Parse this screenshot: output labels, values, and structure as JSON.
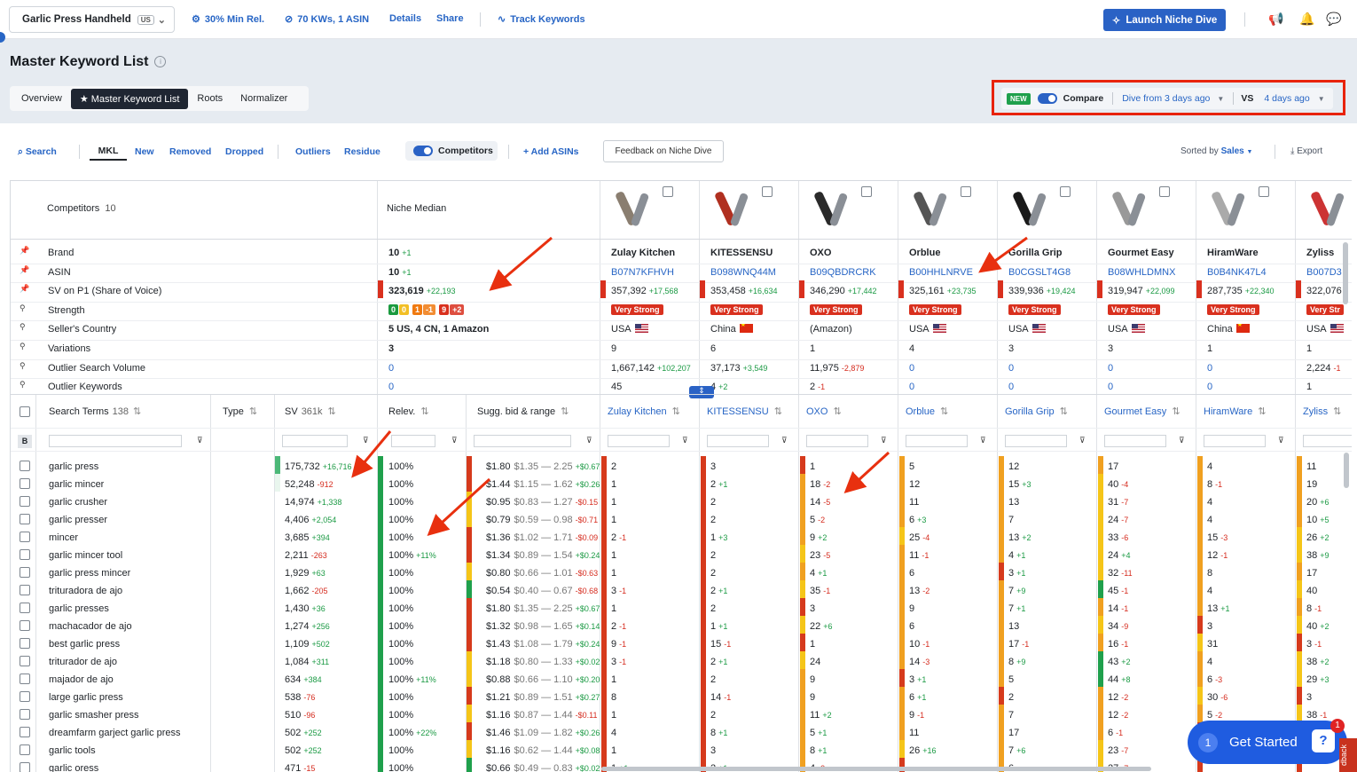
{
  "topbar": {
    "product": "Garlic Press Handheld",
    "market": "US",
    "min_rel": "30% Min Rel.",
    "kws": "70 KWs, 1 ASIN",
    "details": "Details",
    "share": "Share",
    "track": "Track Keywords",
    "launch": "Launch Niche Dive"
  },
  "page": {
    "title": "Master Keyword List",
    "tabs": [
      "Overview",
      "Master Keyword List",
      "Roots",
      "Normalizer"
    ]
  },
  "compare": {
    "new": "NEW",
    "label": "Compare",
    "from": "Dive from 3 days ago",
    "vs": "VS",
    "to": "4 days ago"
  },
  "toolbar": {
    "search": "Search",
    "mkl": "MKL",
    "new": "New",
    "removed": "Removed",
    "dropped": "Dropped",
    "outliers": "Outliers",
    "residue": "Residue",
    "competitors": "Competitors",
    "add": "+ Add ASINs",
    "feedback": "Feedback on Niche Dive",
    "sorted": "Sorted by",
    "sorted_val": "Sales",
    "export": "Export"
  },
  "header": {
    "competitors_label": "Competitors",
    "competitors_count": "10",
    "niche_median": "Niche Median"
  },
  "attrs": [
    "Brand",
    "ASIN",
    "SV on P1 (Share of Voice)",
    "Strength",
    "Seller's Country",
    "Variations",
    "Outlier Search Volume",
    "Outlier Keywords"
  ],
  "median": {
    "brand": "10",
    "brand_d": "+1",
    "asin": "10",
    "asin_d": "+1",
    "sv": "323,619",
    "sv_d": "+22,193",
    "country": "5 US, 4 CN, 1 Amazon",
    "variations": "3",
    "osv": "0",
    "okw": "0",
    "strength": [
      {
        "v": "0",
        "c": "#1a9a3f"
      },
      {
        "v": "0",
        "c": "#f0b400"
      },
      {
        "v": "1",
        "c": "#f07a10"
      },
      {
        "v": "-1",
        "c": "#f07a10"
      },
      {
        "v": "9",
        "c": "#d9301e"
      },
      {
        "v": "+2",
        "c": "#d9301e"
      }
    ]
  },
  "competitors": [
    {
      "brand": "Zulay Kitchen",
      "asin": "B07N7KFHVH",
      "sv": "357,392",
      "sv_d": "+17,568",
      "strength": "Very Strong",
      "country": "USA",
      "flag": "us",
      "var": "9",
      "osv": "1,667,142",
      "osv_d": "+102,207",
      "okw": "45",
      "okw_d": ""
    },
    {
      "brand": "KITESSENSU",
      "asin": "B098WNQ44M",
      "sv": "353,458",
      "sv_d": "+16,634",
      "strength": "Very Strong",
      "country": "China",
      "flag": "cn",
      "var": "6",
      "osv": "37,173",
      "osv_d": "+3,549",
      "okw": "4",
      "okw_d": "+2"
    },
    {
      "brand": "OXO",
      "asin": "B09QBDRCRK",
      "sv": "346,290",
      "sv_d": "+17,442",
      "strength": "Very Strong",
      "country": "(Amazon)",
      "flag": "",
      "var": "1",
      "osv": "11,975",
      "osv_d": "-2,879",
      "okw": "2",
      "okw_d": "-1"
    },
    {
      "brand": "Orblue",
      "asin": "B00HHLNRVE",
      "sv": "325,161",
      "sv_d": "+23,735",
      "strength": "Very Strong",
      "country": "USA",
      "flag": "us",
      "var": "4",
      "osv": "0",
      "osv_d": "",
      "okw": "0",
      "okw_d": ""
    },
    {
      "brand": "Gorilla Grip",
      "asin": "B0CGSLT4G8",
      "sv": "339,936",
      "sv_d": "+19,424",
      "strength": "Very Strong",
      "country": "USA",
      "flag": "us",
      "var": "3",
      "osv": "0",
      "osv_d": "",
      "okw": "0",
      "okw_d": ""
    },
    {
      "brand": "Gourmet Easy",
      "asin": "B08WHLDMNX",
      "sv": "319,947",
      "sv_d": "+22,099",
      "strength": "Very Strong",
      "country": "USA",
      "flag": "us",
      "var": "3",
      "osv": "0",
      "osv_d": "",
      "okw": "0",
      "okw_d": ""
    },
    {
      "brand": "HiramWare",
      "asin": "B0B4NK47L4",
      "sv": "287,735",
      "sv_d": "+22,340",
      "strength": "Very Strong",
      "country": "China",
      "flag": "cn",
      "var": "1",
      "osv": "0",
      "osv_d": "",
      "okw": "0",
      "okw_d": ""
    },
    {
      "brand": "Zyliss",
      "asin": "B007D3",
      "sv": "322,076",
      "sv_d": "",
      "strength": "Very Str",
      "country": "USA",
      "flag": "us",
      "var": "1",
      "osv": "2,224",
      "osv_d": "-1",
      "okw": "1",
      "okw_d": ""
    }
  ],
  "kwheader": {
    "search_terms": "Search Terms",
    "count": "138",
    "type": "Type",
    "sv": "SV",
    "sv_total": "361k",
    "relev": "Relev.",
    "bid": "Sugg. bid & range",
    "b": "B"
  },
  "rows": [
    {
      "t": "garlic press",
      "sv": "175,732",
      "svd": "+16,716",
      "rel": "100%",
      "reld": "",
      "bid": "$1.80",
      "lo": "$1.35",
      "hi": "2.25",
      "bd": "+$0.67",
      "r": [
        [
          "2",
          ""
        ],
        [
          "3",
          ""
        ],
        [
          "1",
          ""
        ],
        [
          "5",
          ""
        ],
        [
          "12",
          ""
        ],
        [
          "17",
          ""
        ],
        [
          "4",
          ""
        ],
        [
          "11",
          ""
        ]
      ]
    },
    {
      "t": "garlic mincer",
      "sv": "52,248",
      "svd": "-912",
      "rel": "100%",
      "reld": "",
      "bid": "$1.44",
      "lo": "$1.15",
      "hi": "1.62",
      "bd": "+$0.26",
      "r": [
        [
          "1",
          ""
        ],
        [
          "2",
          "+1"
        ],
        [
          "18",
          "-2"
        ],
        [
          "12",
          ""
        ],
        [
          "15",
          "+3"
        ],
        [
          "40",
          "-4"
        ],
        [
          "8",
          "-1"
        ],
        [
          "19",
          ""
        ]
      ]
    },
    {
      "t": "garlic crusher",
      "sv": "14,974",
      "svd": "+1,338",
      "rel": "100%",
      "reld": "",
      "bid": "$0.95",
      "lo": "$0.83",
      "hi": "1.27",
      "bd": "-$0.15",
      "r": [
        [
          "1",
          ""
        ],
        [
          "2",
          ""
        ],
        [
          "14",
          "-5"
        ],
        [
          "11",
          ""
        ],
        [
          "13",
          ""
        ],
        [
          "31",
          "-7"
        ],
        [
          "4",
          ""
        ],
        [
          "20",
          "+6"
        ]
      ]
    },
    {
      "t": "garlic presser",
      "sv": "4,406",
      "svd": "+2,054",
      "rel": "100%",
      "reld": "",
      "bid": "$0.79",
      "lo": "$0.59",
      "hi": "0.98",
      "bd": "-$0.71",
      "r": [
        [
          "1",
          ""
        ],
        [
          "2",
          ""
        ],
        [
          "5",
          "-2"
        ],
        [
          "6",
          "+3"
        ],
        [
          "7",
          ""
        ],
        [
          "24",
          "-7"
        ],
        [
          "4",
          ""
        ],
        [
          "10",
          "+5"
        ]
      ]
    },
    {
      "t": "mincer",
      "sv": "3,685",
      "svd": "+394",
      "rel": "100%",
      "reld": "",
      "bid": "$1.36",
      "lo": "$1.02",
      "hi": "1.71",
      "bd": "-$0.09",
      "r": [
        [
          "2",
          "-1"
        ],
        [
          "1",
          "+3"
        ],
        [
          "9",
          "+2"
        ],
        [
          "25",
          "-4"
        ],
        [
          "13",
          "+2"
        ],
        [
          "33",
          "-6"
        ],
        [
          "15",
          "-3"
        ],
        [
          "26",
          "+2"
        ]
      ]
    },
    {
      "t": "garlic mincer tool",
      "sv": "2,211",
      "svd": "-263",
      "rel": "100%",
      "reld": "+11%",
      "bid": "$1.34",
      "lo": "$0.89",
      "hi": "1.54",
      "bd": "+$0.24",
      "r": [
        [
          "1",
          ""
        ],
        [
          "2",
          ""
        ],
        [
          "23",
          "-5"
        ],
        [
          "11",
          "-1"
        ],
        [
          "4",
          "+1"
        ],
        [
          "24",
          "+4"
        ],
        [
          "12",
          "-1"
        ],
        [
          "38",
          "+9"
        ]
      ]
    },
    {
      "t": "garlic press mincer",
      "sv": "1,929",
      "svd": "+63",
      "rel": "100%",
      "reld": "",
      "bid": "$0.80",
      "lo": "$0.66",
      "hi": "1.01",
      "bd": "-$0.63",
      "r": [
        [
          "1",
          ""
        ],
        [
          "2",
          ""
        ],
        [
          "4",
          "+1"
        ],
        [
          "6",
          ""
        ],
        [
          "3",
          "+1"
        ],
        [
          "32",
          "-11"
        ],
        [
          "8",
          ""
        ],
        [
          "17",
          ""
        ]
      ]
    },
    {
      "t": "trituradora de ajo",
      "sv": "1,662",
      "svd": "-205",
      "rel": "100%",
      "reld": "",
      "bid": "$0.54",
      "lo": "$0.40",
      "hi": "0.67",
      "bd": "-$0.68",
      "r": [
        [
          "3",
          "-1"
        ],
        [
          "2",
          "+1"
        ],
        [
          "35",
          "-1"
        ],
        [
          "13",
          "-2"
        ],
        [
          "7",
          "+9"
        ],
        [
          "45",
          "-1"
        ],
        [
          "4",
          ""
        ],
        [
          "40",
          ""
        ]
      ]
    },
    {
      "t": "garlic presses",
      "sv": "1,430",
      "svd": "+36",
      "rel": "100%",
      "reld": "",
      "bid": "$1.80",
      "lo": "$1.35",
      "hi": "2.25",
      "bd": "+$0.67",
      "r": [
        [
          "1",
          ""
        ],
        [
          "2",
          ""
        ],
        [
          "3",
          ""
        ],
        [
          "9",
          ""
        ],
        [
          "7",
          "+1"
        ],
        [
          "14",
          "-1"
        ],
        [
          "13",
          "+1"
        ],
        [
          "8",
          "-1"
        ]
      ]
    },
    {
      "t": "machacador de ajo",
      "sv": "1,274",
      "svd": "+256",
      "rel": "100%",
      "reld": "",
      "bid": "$1.32",
      "lo": "$0.98",
      "hi": "1.65",
      "bd": "+$0.14",
      "r": [
        [
          "2",
          "-1"
        ],
        [
          "1",
          "+1"
        ],
        [
          "22",
          "+6"
        ],
        [
          "6",
          ""
        ],
        [
          "13",
          ""
        ],
        [
          "34",
          "-9"
        ],
        [
          "3",
          ""
        ],
        [
          "40",
          "+2"
        ]
      ]
    },
    {
      "t": "best garlic press",
      "sv": "1,109",
      "svd": "+502",
      "rel": "100%",
      "reld": "",
      "bid": "$1.43",
      "lo": "$1.08",
      "hi": "1.79",
      "bd": "+$0.24",
      "r": [
        [
          "9",
          "-1"
        ],
        [
          "15",
          "-1"
        ],
        [
          "1",
          ""
        ],
        [
          "10",
          "-1"
        ],
        [
          "17",
          "-1"
        ],
        [
          "16",
          "-1"
        ],
        [
          "31",
          ""
        ],
        [
          "3",
          "-1"
        ]
      ]
    },
    {
      "t": "triturador de ajo",
      "sv": "1,084",
      "svd": "+311",
      "rel": "100%",
      "reld": "",
      "bid": "$1.18",
      "lo": "$0.80",
      "hi": "1.33",
      "bd": "+$0.02",
      "r": [
        [
          "3",
          "-1"
        ],
        [
          "2",
          "+1"
        ],
        [
          "24",
          ""
        ],
        [
          "14",
          "-3"
        ],
        [
          "8",
          "+9"
        ],
        [
          "43",
          "+2"
        ],
        [
          "4",
          ""
        ],
        [
          "38",
          "+2"
        ]
      ]
    },
    {
      "t": "majador de ajo",
      "sv": "634",
      "svd": "+384",
      "rel": "100%",
      "reld": "+11%",
      "bid": "$0.88",
      "lo": "$0.66",
      "hi": "1.10",
      "bd": "+$0.20",
      "r": [
        [
          "1",
          ""
        ],
        [
          "2",
          ""
        ],
        [
          "9",
          ""
        ],
        [
          "3",
          "+1"
        ],
        [
          "5",
          ""
        ],
        [
          "44",
          "+8"
        ],
        [
          "6",
          "-3"
        ],
        [
          "29",
          "+3"
        ]
      ]
    },
    {
      "t": "large garlic press",
      "sv": "538",
      "svd": "-76",
      "rel": "100%",
      "reld": "",
      "bid": "$1.21",
      "lo": "$0.89",
      "hi": "1.51",
      "bd": "+$0.27",
      "r": [
        [
          "8",
          ""
        ],
        [
          "14",
          "-1"
        ],
        [
          "9",
          ""
        ],
        [
          "6",
          "+1"
        ],
        [
          "2",
          ""
        ],
        [
          "12",
          "-2"
        ],
        [
          "30",
          "-6"
        ],
        [
          "3",
          ""
        ]
      ]
    },
    {
      "t": "garlic smasher press",
      "sv": "510",
      "svd": "-96",
      "rel": "100%",
      "reld": "",
      "bid": "$1.16",
      "lo": "$0.87",
      "hi": "1.44",
      "bd": "-$0.11",
      "r": [
        [
          "1",
          ""
        ],
        [
          "2",
          ""
        ],
        [
          "11",
          "+2"
        ],
        [
          "9",
          "-1"
        ],
        [
          "7",
          ""
        ],
        [
          "12",
          "-2"
        ],
        [
          "5",
          "-2"
        ],
        [
          "38",
          "-1"
        ]
      ]
    },
    {
      "t": "dreamfarm garject garlic press",
      "sv": "502",
      "svd": "+252",
      "rel": "100%",
      "reld": "+22%",
      "bid": "$1.46",
      "lo": "$1.09",
      "hi": "1.82",
      "bd": "+$0.26",
      "r": [
        [
          "4",
          ""
        ],
        [
          "8",
          "+1"
        ],
        [
          "5",
          "+1"
        ],
        [
          "11",
          ""
        ],
        [
          "17",
          ""
        ],
        [
          "6",
          "-1"
        ],
        [
          "",
          ""
        ],
        [
          "",
          ""
        ]
      ]
    },
    {
      "t": "garlic tools",
      "sv": "502",
      "svd": "+252",
      "rel": "100%",
      "reld": "",
      "bid": "$1.16",
      "lo": "$0.62",
      "hi": "1.44",
      "bd": "+$0.08",
      "r": [
        [
          "1",
          ""
        ],
        [
          "3",
          ""
        ],
        [
          "8",
          "+1"
        ],
        [
          "26",
          "+16"
        ],
        [
          "7",
          "+6"
        ],
        [
          "23",
          "-7"
        ],
        [
          "",
          ""
        ],
        [
          "",
          ""
        ]
      ]
    },
    {
      "t": "garlic oress",
      "sv": "471",
      "svd": "-15",
      "rel": "100%",
      "reld": "",
      "bid": "$0.66",
      "lo": "$0.49",
      "hi": "0.83",
      "bd": "+$0.02",
      "r": [
        [
          "1",
          "+1"
        ],
        [
          "2",
          "+1"
        ],
        [
          "4",
          "-3"
        ],
        [
          "",
          ""
        ],
        [
          "6",
          ""
        ],
        [
          "27",
          "-7"
        ],
        [
          "",
          ""
        ],
        [
          "",
          ""
        ]
      ]
    }
  ],
  "widget": {
    "num": "1",
    "label": "Get Started",
    "badge": "1",
    "side": "dback"
  },
  "colors": {
    "accent": "#2a62c5",
    "highlight": "#e8230a",
    "green": "#1b9a44",
    "red": "#d52b1e"
  }
}
